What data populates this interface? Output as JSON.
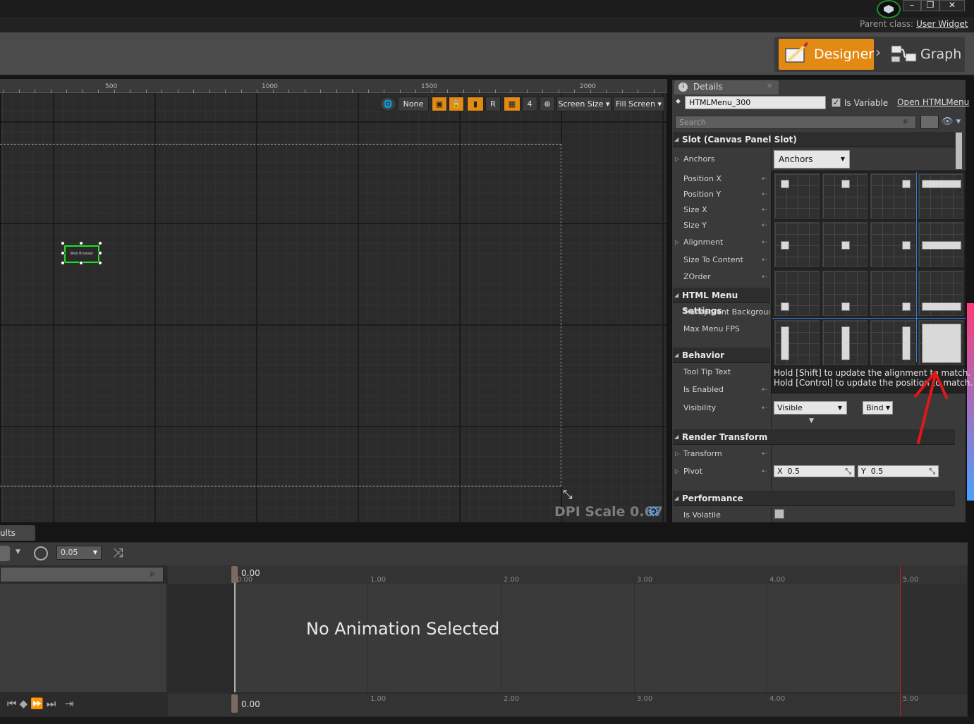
{
  "window": {
    "parent_class_label": "Parent class:",
    "parent_class_value": "User Widget",
    "minimize_icon": "minimize-icon",
    "restore_icon": "restore-icon",
    "close_icon": "close-icon"
  },
  "modes": {
    "designer_label": "Designer",
    "graph_label": "Graph",
    "active": "Designer",
    "accent_color": "#e28a14"
  },
  "canvas": {
    "ruler_ticks": [
      "500",
      "1000",
      "1500",
      "2000"
    ],
    "widget_label": "Web Browser",
    "dpi_scale_text": "DPI Scale 0.67",
    "toolbar": {
      "none_label": "None",
      "r_label": "R",
      "grid_snap_value": "4",
      "screen_size_label": "Screen Size",
      "fill_screen_label": "Fill Screen"
    }
  },
  "details": {
    "tab_title": "Details",
    "widget_name": "HTMLMenu_300",
    "is_variable_label": "Is Variable",
    "is_variable_checked": true,
    "open_link": "Open HTMLMenu",
    "search_placeholder": "Search",
    "sections": {
      "slot": "Slot (Canvas Panel Slot)",
      "html_menu": "HTML Menu Settings",
      "behavior": "Behavior",
      "render_transform": "Render Transform",
      "performance": "Performance"
    },
    "slot_props": {
      "anchors": "Anchors",
      "position_x": "Position X",
      "position_y": "Position Y",
      "size_x": "Size X",
      "size_y": "Size Y",
      "alignment": "Alignment",
      "size_to_content": "Size To Content",
      "zorder": "ZOrder"
    },
    "anchors_dropdown": "Anchors",
    "html_props": {
      "transparent_background": "Transparent Background",
      "max_menu_fps": "Max Menu FPS"
    },
    "behavior_props": {
      "tool_tip_text": "Tool Tip Text",
      "is_enabled": "Is Enabled",
      "visibility": "Visibility"
    },
    "visibility_value": "Visible",
    "bind_label": "Bind",
    "anchor_hint_line1": "Hold [Shift] to update the alignment to match.",
    "anchor_hint_line2": "Hold [Control] to update the position to match.",
    "render_props": {
      "transform": "Transform",
      "pivot": "Pivot"
    },
    "pivot_x_label": "X",
    "pivot_x_value": "0.5",
    "pivot_y_label": "Y",
    "pivot_y_value": "0.5",
    "performance_props": {
      "is_volatile": "Is Volatile"
    }
  },
  "timeline": {
    "results_tab": "ults",
    "speed_value": "0.05",
    "time_labels": [
      "0.00",
      "1.00",
      "2.00",
      "3.00",
      "4.00",
      "5.00"
    ],
    "playhead_time_top": "0.00",
    "playhead_time_bottom": "0.00",
    "empty_message": "No Animation Selected"
  },
  "annotation": {
    "arrow_color": "#e01818"
  }
}
